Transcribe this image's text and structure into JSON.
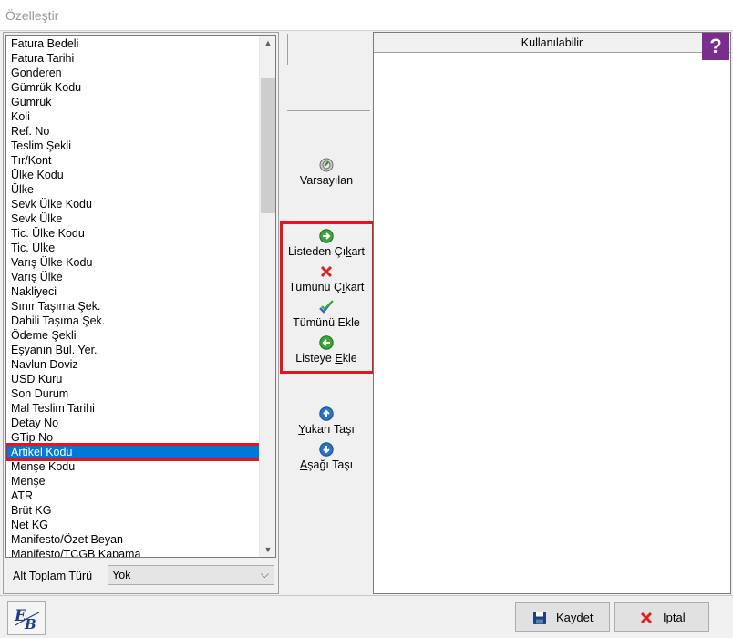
{
  "window": {
    "title": "Özelleştir"
  },
  "left_list": {
    "items": [
      "Fatura Bedeli",
      "Fatura Tarihi",
      "Gonderen",
      "Gümrük Kodu",
      "Gümrük",
      "Koli",
      "Ref. No",
      "Teslim Şekli",
      "Tır/Kont",
      "Ülke Kodu",
      "Ülke",
      "Sevk Ülke Kodu",
      "Sevk Ülke",
      "Tic. Ülke Kodu",
      "Tic. Ülke",
      "Varış Ülke Kodu",
      "Varış Ülke",
      "Nakliyeci",
      "Sınır Taşıma Şek.",
      "Dahili Taşıma Şek.",
      "Ödeme Şekli",
      "Eşyanın Bul. Yer.",
      "Navlun Doviz",
      "USD Kuru",
      "Son Durum",
      "Mal Teslim Tarihi",
      "Detay No",
      "GTip No",
      "Artikel Kodu",
      "Menşe Kodu",
      "Menşe",
      "ATR",
      "Brüt KG",
      "Net KG",
      "Manifesto/Özet Beyan",
      "Manifesto/TCGB Kapama"
    ],
    "selected": "Artikel Kodu"
  },
  "subtotal": {
    "label": "Alt Toplam Türü",
    "value": "Yok"
  },
  "middle": {
    "defaults": {
      "label": "Varsayılan",
      "icon": "defaults-icon"
    },
    "remove": {
      "pre": "Listeden Çı",
      "ul": "k",
      "post": "art",
      "icon": "arrow-right-green-icon"
    },
    "remove_all": {
      "pre": "Tümünü Ç",
      "ul": "ı",
      "post": "kart",
      "icon": "red-x-icon"
    },
    "add_all": {
      "pre": "Tümünü Ekle",
      "ul": "",
      "post": "",
      "icon": "double-check-icon"
    },
    "add": {
      "pre": "Listeye ",
      "ul": "E",
      "post": "kle",
      "icon": "arrow-left-green-icon"
    },
    "move_up": {
      "pre": "",
      "ul": "Y",
      "post": "ukarı Taşı",
      "icon": "arrow-up-blue-icon"
    },
    "move_down": {
      "pre": "",
      "ul": "A",
      "post": "şağı Taşı",
      "icon": "arrow-down-blue-icon"
    }
  },
  "right": {
    "header": "Kullanılabilir",
    "help": "?"
  },
  "bottom": {
    "save": "Kaydet",
    "cancel_ul": "İ",
    "cancel_rest": "ptal"
  },
  "colors": {
    "selection": "#0078d7",
    "highlight_border": "#e8141d",
    "help_bg": "#7b2d8e"
  }
}
